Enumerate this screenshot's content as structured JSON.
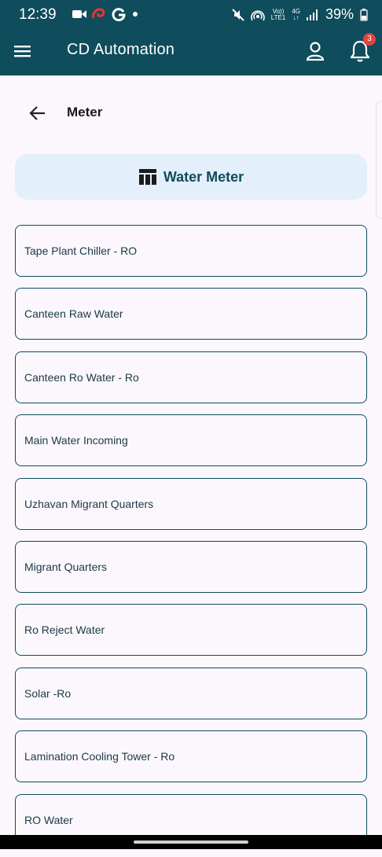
{
  "status_bar": {
    "time": "12:39",
    "battery": "39%",
    "volte_top": "Vo))",
    "volte_bottom": "LTE1",
    "network_top": "4G",
    "network_bottom": "↓↑"
  },
  "app_bar": {
    "title": "CD Automation",
    "notification_count": "3"
  },
  "page": {
    "title": "Meter"
  },
  "category": {
    "label": "Water Meter"
  },
  "meters": [
    "Tape Plant Chiller - RO",
    "Canteen Raw Water",
    "Canteen Ro Water - Ro",
    "Main Water Incoming",
    "Uzhavan Migrant Quarters",
    "Migrant Quarters",
    "Ro Reject Water",
    "Solar -Ro",
    "Lamination Cooling Tower - Ro",
    "RO Water"
  ],
  "colors": {
    "primary": "#0f4c5c",
    "category_bg": "#e3effb",
    "page_bg": "#fbf7fc",
    "badge": "#e5423b"
  },
  "icons": [
    "video-camera-icon",
    "airtel-icon",
    "google-icon",
    "mute-icon",
    "hotspot-icon",
    "signal-icon",
    "battery-icon",
    "menu-icon",
    "profile-icon",
    "bell-icon",
    "back-arrow-icon",
    "table-icon"
  ]
}
